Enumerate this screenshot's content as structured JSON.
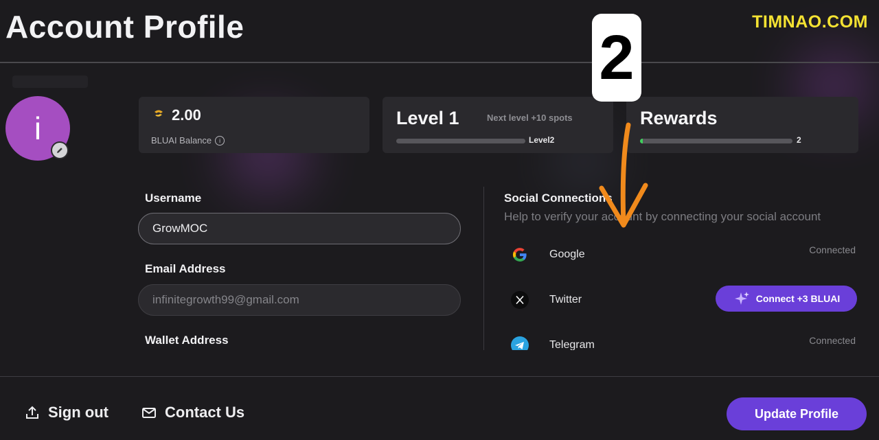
{
  "header": {
    "title": "Account Profile",
    "watermark": "TIMNAO.COM"
  },
  "avatar": {
    "initial": "i",
    "color": "#a54ec1"
  },
  "stats": {
    "balance": {
      "value": "2.00",
      "label": "BLUAI Balance"
    },
    "level": {
      "title": "Level 1",
      "next": "Next level +10 spots",
      "next_level": "Level2",
      "progress": 0.0
    },
    "rewards": {
      "title": "Rewards",
      "count": "2",
      "progress": 0.02
    }
  },
  "form": {
    "username_label": "Username",
    "username_value": "GrowMOC",
    "email_label": "Email Address",
    "email_placeholder": "infinitegrowth99@gmail.com",
    "wallet_label": "Wallet Address"
  },
  "social": {
    "title": "Social Connections",
    "subtitle": "Help to verify your account by connecting your social account",
    "items": [
      {
        "name": "Google",
        "status": "Connected",
        "icon": "google-icon"
      },
      {
        "name": "Twitter",
        "action": "Connect +3 BLUAI",
        "icon": "x-icon"
      },
      {
        "name": "Telegram",
        "status": "Connected",
        "icon": "telegram-icon"
      }
    ]
  },
  "footer": {
    "sign_out": "Sign out",
    "contact": "Contact Us",
    "update": "Update Profile"
  },
  "annotation": {
    "number": "2"
  },
  "colors": {
    "accent": "#6a3fd9",
    "progress": "#3fcf5c",
    "annotation_arrow": "#f08a1c",
    "watermark": "#f4e232"
  }
}
